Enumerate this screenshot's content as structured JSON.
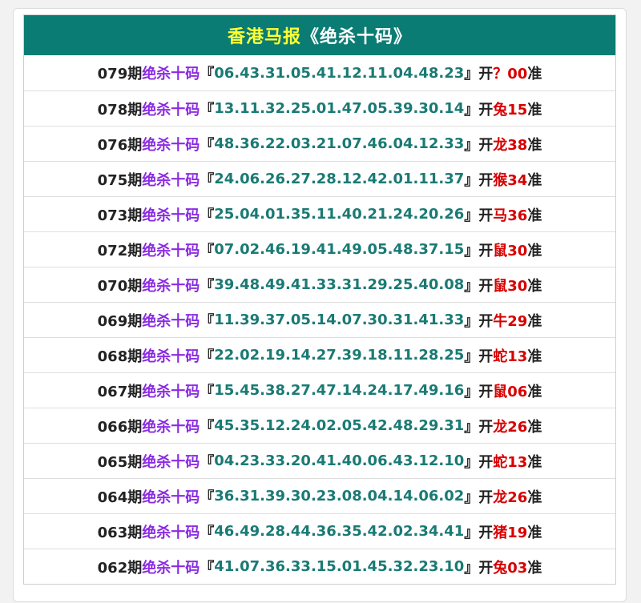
{
  "colors": {
    "header_bg": "#0a7c74",
    "title_primary": "#ffff33",
    "title_secondary": "#ffffff",
    "label": "#8a2be2",
    "numbers": "#1a7a74",
    "result": "#d80000",
    "text": "#222222"
  },
  "header": {
    "title": "香港马报",
    "subtitle": "《绝杀十码》"
  },
  "rows": [
    {
      "period": "079期",
      "label": "绝杀十码",
      "open_bracket": "『",
      "numbers": "06.43.31.05.41.12.11.04.48.23",
      "close_bracket": "』",
      "open": "开",
      "result": "？00",
      "accurate": "准"
    },
    {
      "period": "078期",
      "label": "绝杀十码",
      "open_bracket": "『",
      "numbers": "13.11.32.25.01.47.05.39.30.14",
      "close_bracket": "』",
      "open": "开",
      "result": "兔15",
      "accurate": "准"
    },
    {
      "period": "076期",
      "label": "绝杀十码",
      "open_bracket": "『",
      "numbers": "48.36.22.03.21.07.46.04.12.33",
      "close_bracket": "』",
      "open": "开",
      "result": "龙38",
      "accurate": "准"
    },
    {
      "period": "075期",
      "label": "绝杀十码",
      "open_bracket": "『",
      "numbers": "24.06.26.27.28.12.42.01.11.37",
      "close_bracket": "』",
      "open": "开",
      "result": "猴34",
      "accurate": "准"
    },
    {
      "period": "073期",
      "label": "绝杀十码",
      "open_bracket": "『",
      "numbers": "25.04.01.35.11.40.21.24.20.26",
      "close_bracket": "』",
      "open": "开",
      "result": "马36",
      "accurate": "准"
    },
    {
      "period": "072期",
      "label": "绝杀十码",
      "open_bracket": "『",
      "numbers": "07.02.46.19.41.49.05.48.37.15",
      "close_bracket": "』",
      "open": "开",
      "result": "鼠30",
      "accurate": "准"
    },
    {
      "period": "070期",
      "label": "绝杀十码",
      "open_bracket": "『",
      "numbers": "39.48.49.41.33.31.29.25.40.08",
      "close_bracket": "』",
      "open": "开",
      "result": "鼠30",
      "accurate": "准"
    },
    {
      "period": "069期",
      "label": "绝杀十码",
      "open_bracket": "『",
      "numbers": "11.39.37.05.14.07.30.31.41.33",
      "close_bracket": "』",
      "open": "开",
      "result": "牛29",
      "accurate": "准"
    },
    {
      "period": "068期",
      "label": "绝杀十码",
      "open_bracket": "『",
      "numbers": "22.02.19.14.27.39.18.11.28.25",
      "close_bracket": "』",
      "open": "开",
      "result": "蛇13",
      "accurate": "准"
    },
    {
      "period": "067期",
      "label": "绝杀十码",
      "open_bracket": "『",
      "numbers": "15.45.38.27.47.14.24.17.49.16",
      "close_bracket": "』",
      "open": "开",
      "result": "鼠06",
      "accurate": "准"
    },
    {
      "period": "066期",
      "label": "绝杀十码",
      "open_bracket": "『",
      "numbers": "45.35.12.24.02.05.42.48.29.31",
      "close_bracket": "』",
      "open": "开",
      "result": "龙26",
      "accurate": "准"
    },
    {
      "period": "065期",
      "label": "绝杀十码",
      "open_bracket": "『",
      "numbers": "04.23.33.20.41.40.06.43.12.10",
      "close_bracket": "』",
      "open": "开",
      "result": "蛇13",
      "accurate": "准"
    },
    {
      "period": "064期",
      "label": "绝杀十码",
      "open_bracket": "『",
      "numbers": "36.31.39.30.23.08.04.14.06.02",
      "close_bracket": "』",
      "open": "开",
      "result": "龙26",
      "accurate": "准"
    },
    {
      "period": "063期",
      "label": "绝杀十码",
      "open_bracket": "『",
      "numbers": "46.49.28.44.36.35.42.02.34.41",
      "close_bracket": "』",
      "open": "开",
      "result": "猪19",
      "accurate": "准"
    },
    {
      "period": "062期",
      "label": "绝杀十码",
      "open_bracket": "『",
      "numbers": "41.07.36.33.15.01.45.32.23.10",
      "close_bracket": "』",
      "open": "开",
      "result": "兔03",
      "accurate": "准"
    }
  ]
}
